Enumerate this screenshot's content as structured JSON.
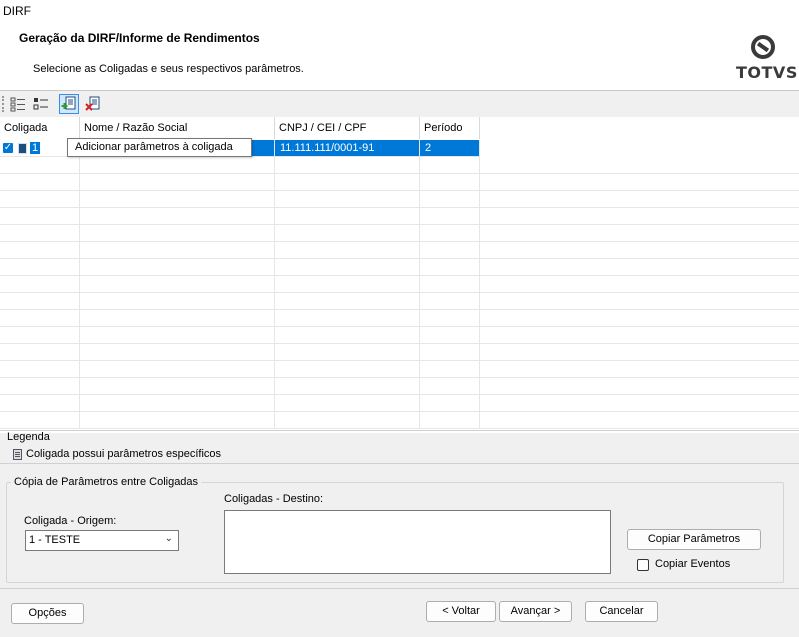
{
  "window": {
    "title": "DIRF"
  },
  "header": {
    "title": "Geração da DIRF/Informe de Rendimentos",
    "subtitle": "Selecione as Coligadas e seus respectivos parâmetros.",
    "logo_text": "TOTVS"
  },
  "toolbar": {
    "buttons": [
      {
        "icon": "select-all-icon"
      },
      {
        "icon": "list-view-icon"
      },
      {
        "icon": "add-params-icon"
      },
      {
        "icon": "remove-params-icon"
      }
    ]
  },
  "tooltip": "Adicionar parâmetros à coligada",
  "grid": {
    "columns": [
      "Coligada",
      "Nome / Razão Social",
      "CNPJ / CEI / CPF",
      "Período"
    ],
    "rows": [
      {
        "coligada": "1",
        "nome": "",
        "cnpj": "11.111.111/0001-91",
        "periodo": "2",
        "checked": true
      }
    ]
  },
  "legend": {
    "title": "Legenda",
    "item": "Coligada possui parâmetros específicos"
  },
  "copy_group": {
    "title": "Cópia de Parâmetros entre Coligadas",
    "origem_label": "Coligada - Origem:",
    "origem_value": "1 - TESTE",
    "destino_label": "Coligadas - Destino:",
    "copy_button": "Copiar Parâmetros",
    "copy_events_label": "Copiar Eventos"
  },
  "footer": {
    "options_button": "Opções",
    "back_button": "< Voltar",
    "next_button": "Avançar >",
    "cancel_button": "Cancelar"
  },
  "colors": {
    "selection": "#0078d7",
    "accent_border": "#3d8ee0"
  }
}
